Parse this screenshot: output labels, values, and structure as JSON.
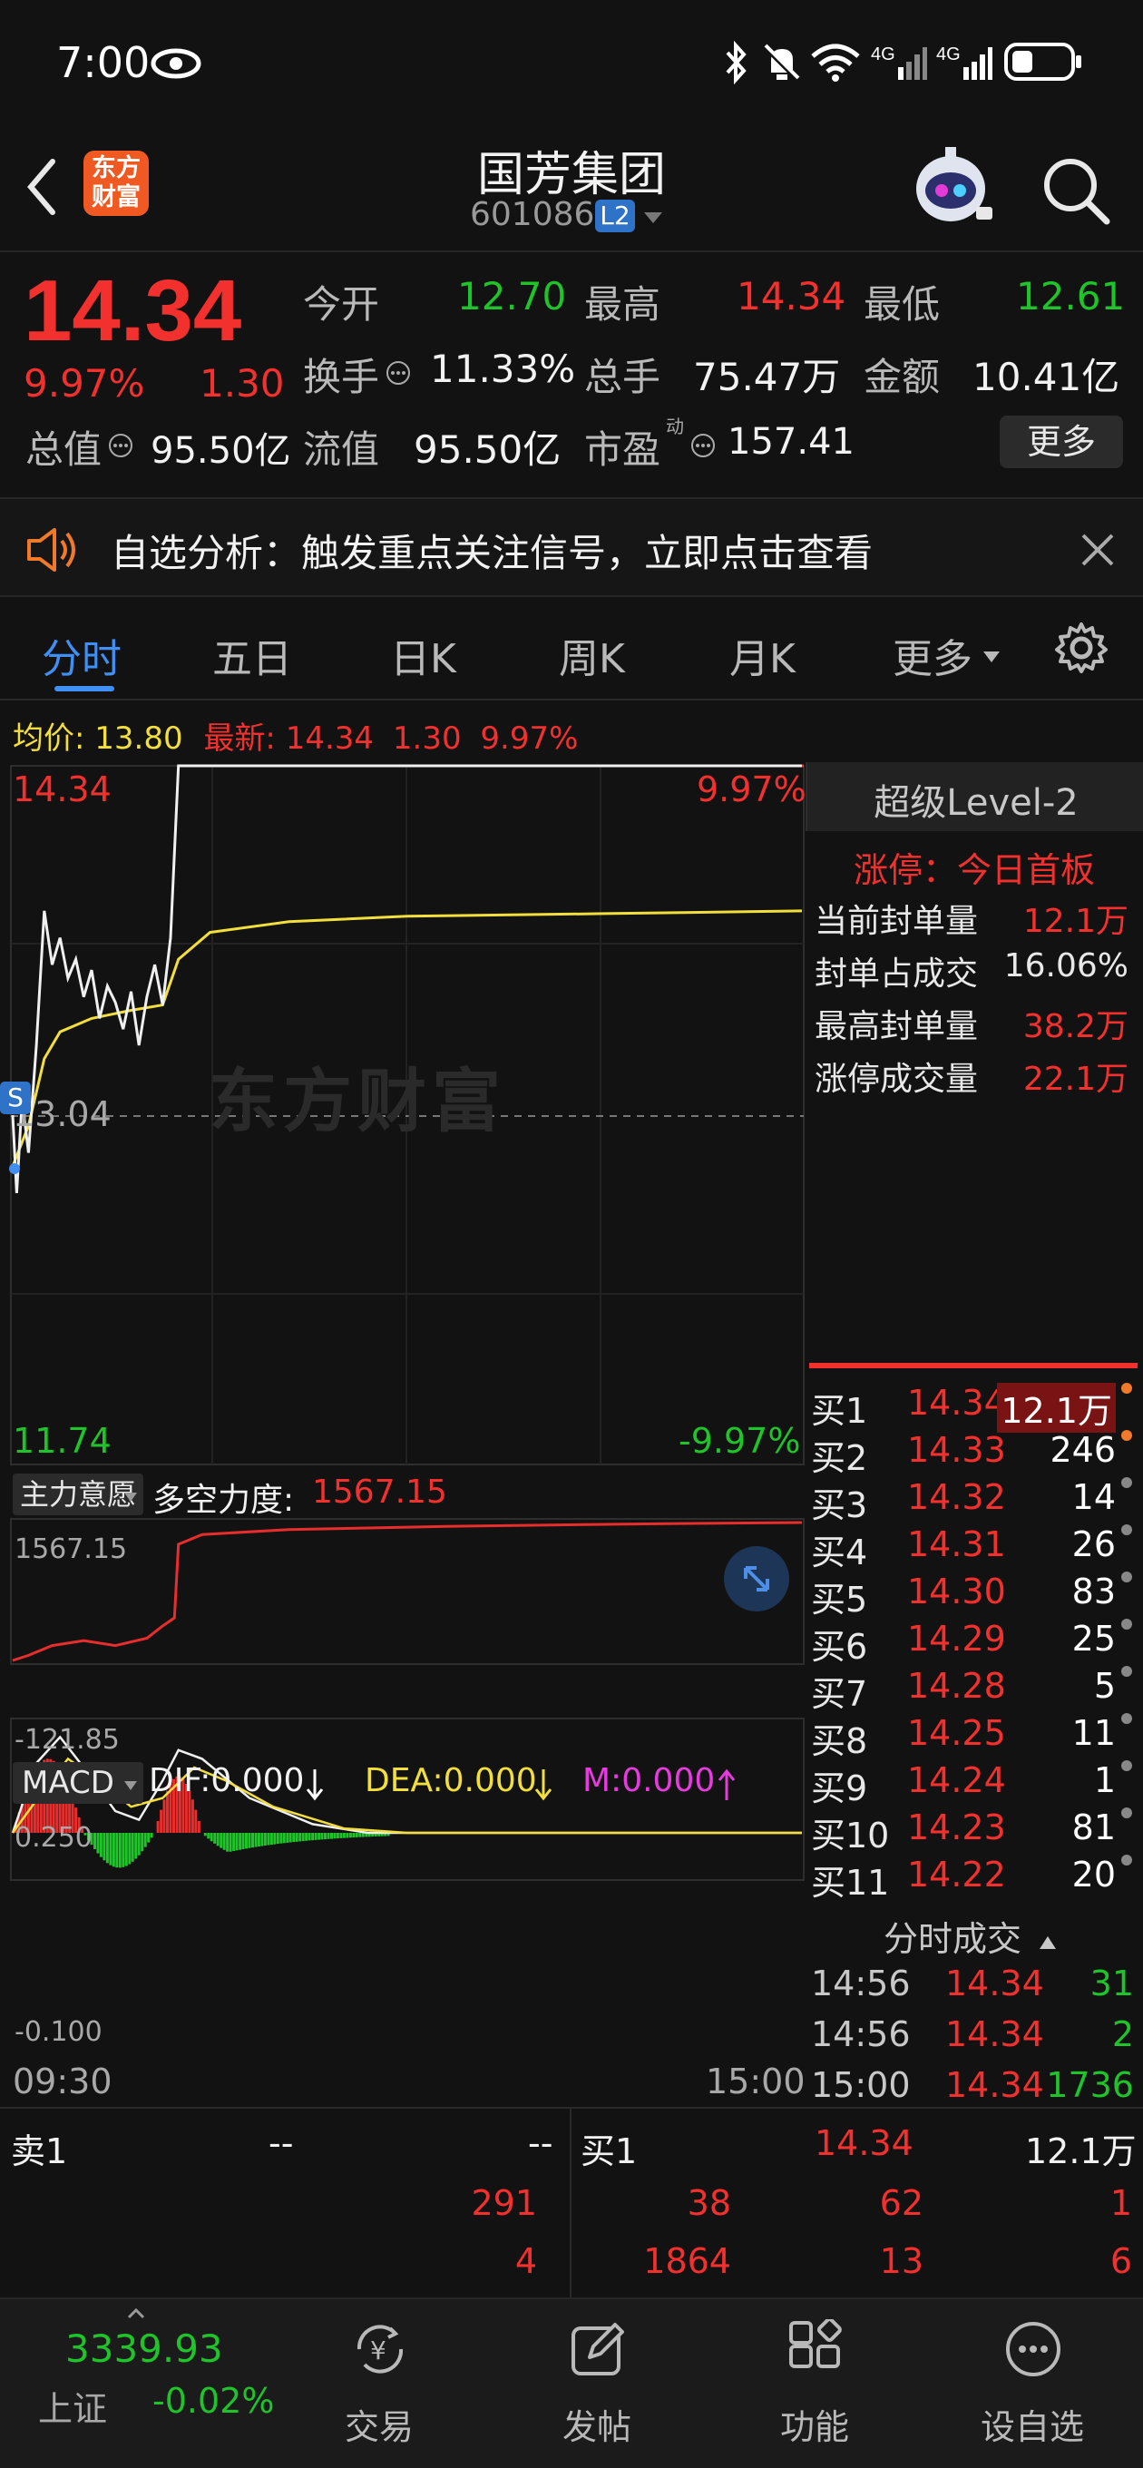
{
  "status": {
    "time": "7:00"
  },
  "header": {
    "stock_name": "国芳集团",
    "stock_code": "601086",
    "l2_badge": "L2",
    "logo_line1": "东方",
    "logo_line2": "财富"
  },
  "quote": {
    "price": "14.34",
    "change_pct": "9.97%",
    "change_amt": "1.30",
    "open_label": "今开",
    "open": "12.70",
    "high_label": "最高",
    "high": "14.34",
    "low_label": "最低",
    "low": "12.61",
    "turnover_rate_label": "换手",
    "turnover_rate": "11.33%",
    "volume_label": "总手",
    "volume": "75.47万",
    "amount_label": "金额",
    "amount": "10.41亿",
    "mktcap_label": "总值",
    "mktcap": "95.50亿",
    "float_label": "流值",
    "float_cap": "95.50亿",
    "pe_label": "市盈",
    "pe_sup": "动",
    "pe": "157.41",
    "more_button": "更多"
  },
  "banner": {
    "text": "自选分析：触发重点关注信号，立即点击查看"
  },
  "tabs": [
    "分时",
    "五日",
    "日K",
    "周K",
    "月K",
    "更多"
  ],
  "info_line": {
    "avg_label": "均价:",
    "avg": "13.80",
    "latest_label": "最新:",
    "latest": "14.34",
    "chg": "1.30",
    "pct": "9.97%"
  },
  "chart": {
    "top_price": "14.34",
    "top_pct": "9.97%",
    "mid_price": "13.04",
    "bottom_price": "11.74",
    "bottom_pct": "-9.97%",
    "watermark": "东方财富",
    "start_time": "09:30",
    "end_time": "15:00",
    "signal_badge": "S"
  },
  "level2": {
    "title": "超级Level-2",
    "limit_label": "涨停：今日首板",
    "rows": [
      {
        "label": "当前封单量",
        "value": "12.1万"
      },
      {
        "label": "封单占成交",
        "value": "16.06%"
      },
      {
        "label": "最高封单量",
        "value": "38.2万"
      },
      {
        "label": "涨停成交量",
        "value": "22.1万"
      }
    ]
  },
  "orderbook": [
    {
      "label": "买1",
      "price": "14.34",
      "qty": "12.1万"
    },
    {
      "label": "买2",
      "price": "14.33",
      "qty": "246"
    },
    {
      "label": "买3",
      "price": "14.32",
      "qty": "14"
    },
    {
      "label": "买4",
      "price": "14.31",
      "qty": "26"
    },
    {
      "label": "买5",
      "price": "14.30",
      "qty": "83"
    },
    {
      "label": "买6",
      "price": "14.29",
      "qty": "25"
    },
    {
      "label": "买7",
      "price": "14.28",
      "qty": "5"
    },
    {
      "label": "买8",
      "price": "14.25",
      "qty": "11"
    },
    {
      "label": "买9",
      "price": "14.24",
      "qty": "1"
    },
    {
      "label": "买10",
      "price": "14.23",
      "qty": "81"
    },
    {
      "label": "买11",
      "price": "14.22",
      "qty": "20"
    }
  ],
  "ticks": {
    "title": "分时成交",
    "rows": [
      {
        "time": "14:56",
        "price": "14.34",
        "vol": "31"
      },
      {
        "time": "14:56",
        "price": "14.34",
        "vol": "2"
      },
      {
        "time": "15:00",
        "price": "14.34",
        "vol": "1736"
      }
    ]
  },
  "indicator1": {
    "selector": "主力意愿",
    "label": "多空力度:",
    "value": "1567.15",
    "max": "1567.15",
    "min": "-121.85"
  },
  "macd": {
    "selector": "MACD",
    "dif": "DIF:0.000",
    "dea": "DEA:0.000",
    "m": "M:0.000",
    "max": "0.250",
    "min": "-0.100"
  },
  "bottom_book": {
    "sell_label": "卖1",
    "sell_price": "--",
    "sell_qty": "--",
    "buy_label": "买1",
    "buy_price": "14.34",
    "buy_qty": "12.1万",
    "row2": [
      "291",
      "38",
      "62",
      "1"
    ],
    "row3": [
      "4",
      "1864",
      "13",
      "6"
    ]
  },
  "navbar": {
    "index_value": "3339.93",
    "index_name": "上证",
    "index_pct": "-0.02%",
    "items": [
      "交易",
      "发帖",
      "功能",
      "设自选"
    ]
  },
  "colors": {
    "up": "#f2302d",
    "down": "#1fc32a",
    "avg_line": "#f3df3c",
    "background": "#121212"
  }
}
